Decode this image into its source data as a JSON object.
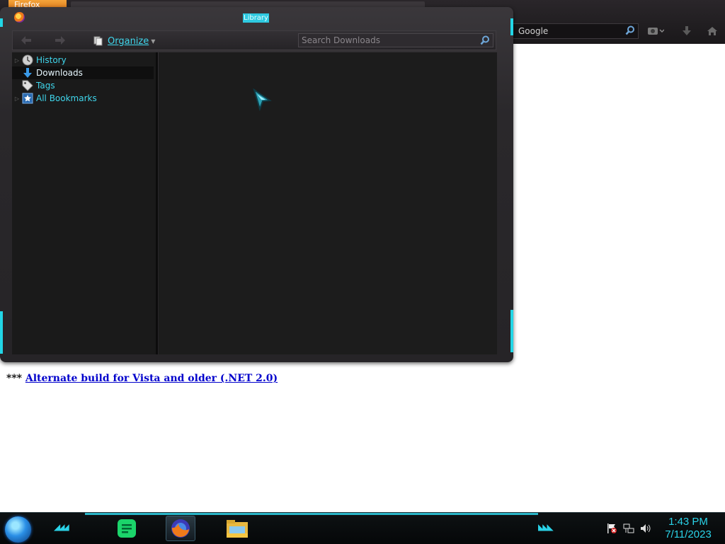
{
  "browser": {
    "tab_label": "Firefox",
    "search_engine_placeholder": "Google"
  },
  "page": {
    "prefix": "*** ",
    "link_text": "Alternate build for Vista and older (.NET 2.0)"
  },
  "library": {
    "title": "Library",
    "organize_label": "Organize",
    "search_placeholder": "Search Downloads",
    "tree": [
      {
        "label": "History",
        "icon": "clock-icon",
        "expandable": true,
        "selected": false
      },
      {
        "label": "Downloads",
        "icon": "download-arrow-icon",
        "expandable": false,
        "selected": true
      },
      {
        "label": "Tags",
        "icon": "tag-icon",
        "expandable": false,
        "selected": false
      },
      {
        "label": "All Bookmarks",
        "icon": "star-bookmark-icon",
        "expandable": true,
        "selected": false
      }
    ]
  },
  "taskbar": {
    "apps": [
      {
        "name": "notes-app-icon",
        "color": "#1bd46a"
      },
      {
        "name": "firefox-icon",
        "color": "#f07a1a",
        "active": true
      },
      {
        "name": "file-explorer-icon",
        "color": "#f5c542"
      }
    ],
    "time": "1:43 PM",
    "date": "7/11/2023"
  },
  "colors": {
    "accent": "#2ad3e8",
    "link": "#0000cc",
    "window_bg": "#1c1c1c"
  }
}
